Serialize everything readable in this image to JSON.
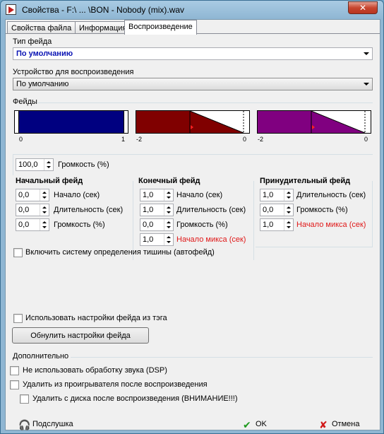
{
  "window": {
    "title": "Свойства - F:\\ ... \\BON - Nobody (mix).wav",
    "close_glyph": "✕"
  },
  "tabs": [
    "Свойства файла",
    "Информация",
    "Воспроизведение"
  ],
  "active_tab": 2,
  "fade_type": {
    "label": "Тип фейда",
    "value": "По умолчанию"
  },
  "device": {
    "label": "Устройство для воспроизведения",
    "value": "По умолчанию"
  },
  "fades": {
    "label": "Фейды",
    "graphs": [
      {
        "color": "#000080",
        "left_tick": "0",
        "right_tick": "1"
      },
      {
        "color": "#800000",
        "left_tick": "-2",
        "right_tick": "0"
      },
      {
        "color": "#800080",
        "left_tick": "-2",
        "right_tick": "0"
      }
    ]
  },
  "volume": {
    "value": "100,0",
    "label": "Громкость (%)"
  },
  "start_fade": {
    "title": "Начальный фейд",
    "fields": [
      {
        "value": "0,0",
        "label": "Начало (сек)"
      },
      {
        "value": "0,0",
        "label": "Длительность (сек)"
      },
      {
        "value": "0,0",
        "label": "Громкость (%)"
      }
    ]
  },
  "end_fade": {
    "title": "Конечный фейд",
    "fields": [
      {
        "value": "1,0",
        "label": "Начало (сек)"
      },
      {
        "value": "1,0",
        "label": "Длительность (сек)"
      },
      {
        "value": "0,0",
        "label": "Громкость (%)"
      },
      {
        "value": "1,0",
        "label": "Начало микса (сек)"
      }
    ]
  },
  "forced_fade": {
    "title": "Принудительный фейд",
    "fields": [
      {
        "value": "1,0",
        "label": "Длительность (сек)"
      },
      {
        "value": "0,0",
        "label": "Громкость (%)"
      },
      {
        "value": "1,0",
        "label": "Начало микса (сек)"
      }
    ]
  },
  "silence_detection": "Включить систему определения тишины (автофейд)",
  "use_tag_settings": "Использовать настройки фейда из тэга",
  "reset_button": "Обнулить настройки фейда",
  "extra": {
    "label": "Дополнительно",
    "no_dsp": "Не использовать обработку звука (DSP)",
    "remove_after": "Удалить из проигрывателя после воспроизведения",
    "delete_after": "Удалить с диска после воспроизведения (ВНИМАНИЕ!!!)"
  },
  "bottom": {
    "listen": "Подслушка",
    "ok": "OK",
    "cancel": "Отмена",
    "ok_check": "✔",
    "cancel_x": "✘",
    "listen_icon": "🎧"
  }
}
